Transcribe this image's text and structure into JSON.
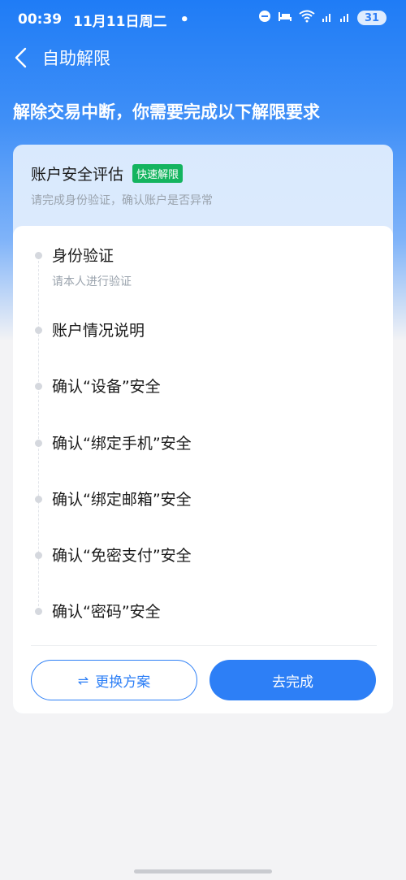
{
  "status_bar": {
    "time": "00:39",
    "date": "11月11日周二",
    "dot": "•",
    "battery": "31",
    "icons": [
      "dnd-icon",
      "bed-icon",
      "wifi-icon",
      "signal-icon",
      "signal-icon",
      "battery-icon"
    ]
  },
  "nav": {
    "title": "自助解限"
  },
  "headline": "解除交易中断，你需要完成以下解限要求",
  "card": {
    "title": "账户安全评估",
    "badge": "快速解限",
    "subtitle": "请完成身份验证，确认账户是否异常",
    "steps": [
      {
        "label": "身份验证",
        "desc": "请本人进行验证"
      },
      {
        "label": "账户情况说明"
      },
      {
        "label": "确认“设备”安全"
      },
      {
        "label": "确认“绑定手机”安全"
      },
      {
        "label": "确认“绑定邮箱”安全"
      },
      {
        "label": "确认“免密支付”安全"
      },
      {
        "label": "确认“密码”安全"
      }
    ],
    "switch_button": "更换方案",
    "switch_icon": "⇌",
    "done_button": "去完成"
  },
  "colors": {
    "primary": "#2d7ff6",
    "badge": "#14b45f",
    "hero_top": "#1f7cf6",
    "background": "#f3f3f5"
  }
}
